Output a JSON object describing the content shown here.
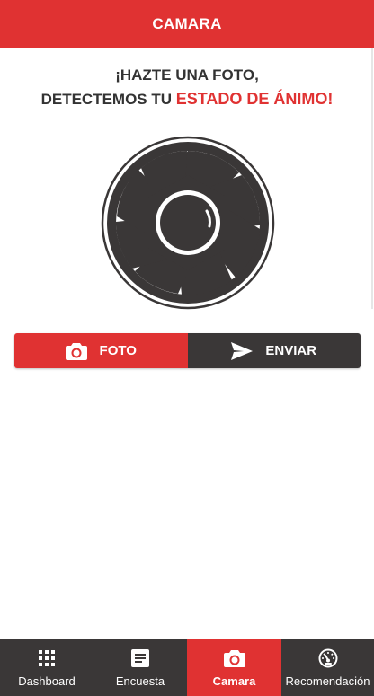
{
  "header": {
    "title": "CAMARA"
  },
  "prompt": {
    "line1": "¡HAZTE UNA FOTO,",
    "line2_prefix": "DETECTEMOS TU ",
    "line2_accent": "ESTADO DE ÁNIMO!"
  },
  "actions": {
    "photo_label": "FOTO",
    "send_label": "ENVIAR"
  },
  "nav": {
    "items": [
      {
        "label": "Dashboard",
        "icon": "grid-icon"
      },
      {
        "label": "Encuesta",
        "icon": "document-icon"
      },
      {
        "label": "Camara",
        "icon": "camera-icon",
        "active": true
      },
      {
        "label": "Recomendación",
        "icon": "speedometer-icon"
      }
    ]
  },
  "colors": {
    "accent": "#e03232",
    "dark": "#3a3737",
    "text": "#333333"
  }
}
